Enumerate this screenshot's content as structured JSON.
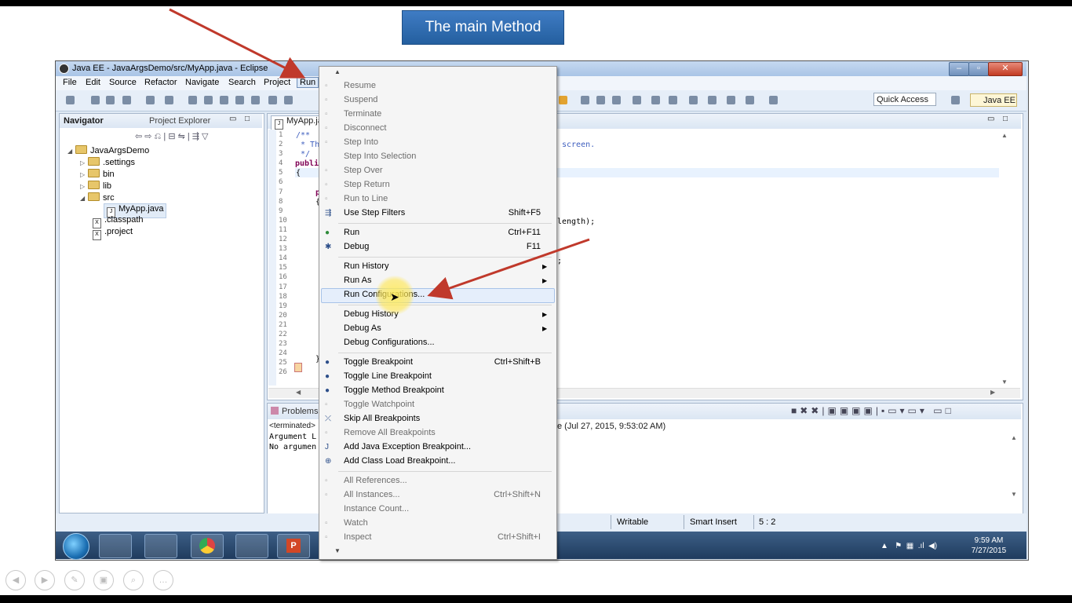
{
  "slide": {
    "title": "The main Method"
  },
  "window": {
    "title": "Java EE - JavaArgsDemo/src/MyApp.java - Eclipse"
  },
  "menubar": [
    "File",
    "Edit",
    "Source",
    "Refactor",
    "Navigate",
    "Search",
    "Project",
    "Run"
  ],
  "toolbar": {
    "quick_access": "Quick Access",
    "perspective": "Java EE"
  },
  "navigator": {
    "tabs": [
      "Navigator",
      "Project Explorer"
    ],
    "tree": [
      {
        "label": "JavaArgsDemo",
        "kind": "project"
      },
      {
        "label": ".settings",
        "kind": "folder"
      },
      {
        "label": "bin",
        "kind": "folder"
      },
      {
        "label": "lib",
        "kind": "folder"
      },
      {
        "label": "src",
        "kind": "folder"
      },
      {
        "label": "MyApp.java",
        "kind": "java"
      },
      {
        "label": ".classpath",
        "kind": "xml"
      },
      {
        "label": ".project",
        "kind": "xml"
      }
    ]
  },
  "editor": {
    "tab": "MyApp.ja",
    "line_numbers": [
      "1",
      "2",
      "3",
      "4",
      "5",
      "6",
      "7",
      "8",
      "9",
      "10",
      "11",
      "12",
      "13",
      "14",
      "15",
      "16",
      "17",
      "18",
      "19",
      "20",
      "21",
      "22",
      "23",
      "24",
      "25",
      "26"
    ],
    "visible_code": {
      "l1": "/**",
      "l2": " * Th",
      "l3": " */",
      "l4": "publi",
      "l5": "{",
      "l7": "p",
      "l8": "{",
      "l24": "}",
      "l2_right": "screen.",
      "l10_right": "length);",
      "l14_right": ";"
    }
  },
  "console": {
    "tab": "Problems",
    "terminated": "<terminated>",
    "terminated_right": "e (Jul 27, 2015, 9:53:02 AM)",
    "line1": "Argument L",
    "line2": "No argumen"
  },
  "status": {
    "writable": "Writable",
    "insert": "Smart Insert",
    "position": "5 : 2"
  },
  "clock": {
    "time": "9:59 AM",
    "date": "7/27/2015"
  },
  "run_menu": [
    {
      "label": "Resume",
      "enabled": false,
      "icon": "resume-icon"
    },
    {
      "label": "Suspend",
      "enabled": false,
      "icon": "suspend-icon"
    },
    {
      "label": "Terminate",
      "enabled": false,
      "icon": "terminate-icon"
    },
    {
      "label": "Disconnect",
      "enabled": false,
      "icon": "disconnect-icon"
    },
    {
      "label": "Step Into",
      "enabled": false,
      "icon": "step-into-icon"
    },
    {
      "label": "Step Into Selection",
      "enabled": false,
      "icon": ""
    },
    {
      "label": "Step Over",
      "enabled": false,
      "icon": "step-over-icon"
    },
    {
      "label": "Step Return",
      "enabled": false,
      "icon": "step-return-icon"
    },
    {
      "label": "Run to Line",
      "enabled": false,
      "icon": "run-to-line-icon"
    },
    {
      "label": "Use Step Filters",
      "enabled": true,
      "shortcut": "Shift+F5",
      "icon": "step-filters-icon"
    },
    {
      "label": "Run",
      "enabled": true,
      "shortcut": "Ctrl+F11",
      "icon": "run-icon"
    },
    {
      "label": "Debug",
      "enabled": true,
      "shortcut": "F11",
      "icon": "debug-icon"
    },
    {
      "label": "Run History",
      "enabled": true,
      "submenu": true
    },
    {
      "label": "Run As",
      "enabled": true,
      "submenu": true
    },
    {
      "label": "Run Configurations...",
      "enabled": true,
      "highlighted": true
    },
    {
      "label": "Debug History",
      "enabled": true,
      "submenu": true
    },
    {
      "label": "Debug As",
      "enabled": true,
      "submenu": true
    },
    {
      "label": "Debug Configurations...",
      "enabled": true
    },
    {
      "label": "Toggle Breakpoint",
      "enabled": true,
      "shortcut": "Ctrl+Shift+B",
      "icon": "breakpoint-icon"
    },
    {
      "label": "Toggle Line Breakpoint",
      "enabled": true,
      "icon": "breakpoint-icon"
    },
    {
      "label": "Toggle Method Breakpoint",
      "enabled": true,
      "icon": "breakpoint-icon"
    },
    {
      "label": "Toggle Watchpoint",
      "enabled": false,
      "icon": "watchpoint-icon"
    },
    {
      "label": "Skip All Breakpoints",
      "enabled": true,
      "icon": "skip-breakpoints-icon"
    },
    {
      "label": "Remove All Breakpoints",
      "enabled": false,
      "icon": "remove-breakpoints-icon"
    },
    {
      "label": "Add Java Exception Breakpoint...",
      "enabled": true,
      "icon": "exception-icon"
    },
    {
      "label": "Add Class Load Breakpoint...",
      "enabled": true,
      "icon": "class-load-icon"
    },
    {
      "label": "All References...",
      "enabled": false,
      "icon": "references-icon"
    },
    {
      "label": "All Instances...",
      "enabled": false,
      "shortcut": "Ctrl+Shift+N",
      "icon": "instances-icon"
    },
    {
      "label": "Instance Count...",
      "enabled": false
    },
    {
      "label": "Watch",
      "enabled": false,
      "icon": "watch-icon"
    },
    {
      "label": "Inspect",
      "enabled": false,
      "shortcut": "Ctrl+Shift+I",
      "icon": "inspect-icon"
    }
  ],
  "colors": {
    "slide_title_bg": "#2f6db4",
    "annotation_arrow": "#c0392b",
    "highlight": "#ffe65a"
  }
}
